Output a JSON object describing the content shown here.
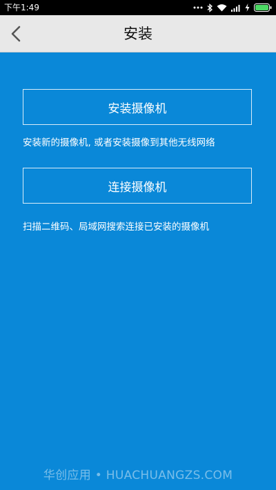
{
  "status_bar": {
    "time": "下午1:49",
    "icons": [
      "more-dots-icon",
      "bluetooth-icon",
      "wifi-icon",
      "signal-icon",
      "charging-icon",
      "battery-icon"
    ],
    "battery_color": "#4cd964"
  },
  "header": {
    "title": "安装",
    "back_icon": "chevron-left-icon"
  },
  "options": [
    {
      "label": "安装摄像机",
      "description": "安装新的摄像机, 或者安装摄像到其他无线网络"
    },
    {
      "label": "连接摄像机",
      "description": "扫描二维码、局域网搜索连接已安装的摄像机"
    }
  ],
  "watermark": "华创应用 • HUACHUANGZS.COM",
  "colors": {
    "background": "#0a88d8",
    "header_bg": "#e8e8e8",
    "status_bar_bg": "#000000"
  }
}
